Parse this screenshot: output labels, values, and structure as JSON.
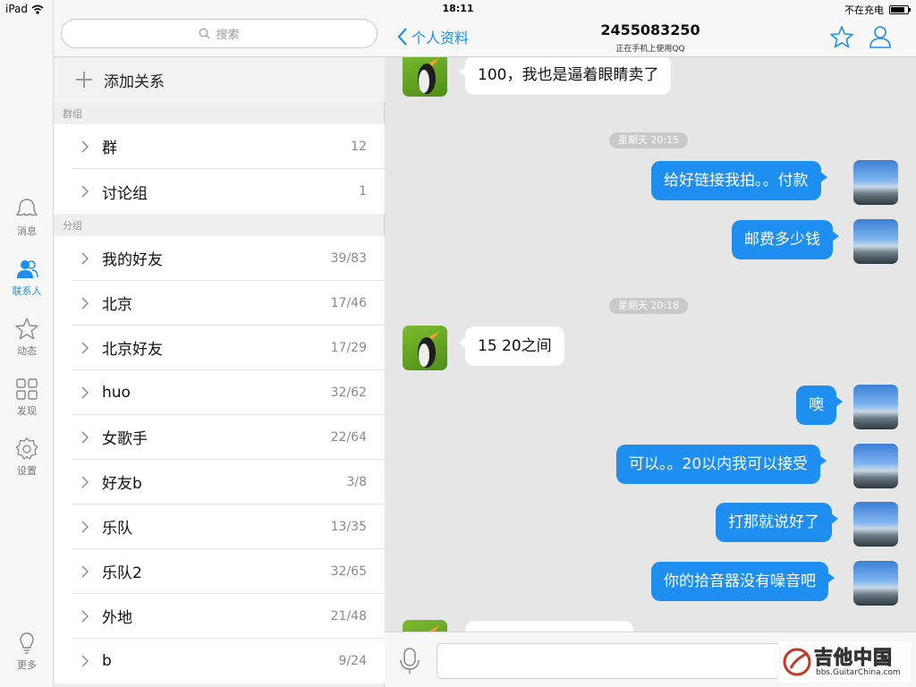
{
  "status_bar": {
    "device": "iPad",
    "time": "18:11",
    "charging": "不在充电",
    "battery_level": 0.85
  },
  "rail": {
    "items": [
      {
        "label": "消息",
        "icon": "chat-bubble-icon"
      },
      {
        "label": "联系人",
        "icon": "contacts-icon",
        "active": true
      },
      {
        "label": "动态",
        "icon": "star-icon"
      },
      {
        "label": "发现",
        "icon": "grid-icon"
      },
      {
        "label": "设置",
        "icon": "gear-icon"
      },
      {
        "label": "更多",
        "icon": "bulb-icon"
      }
    ]
  },
  "contacts": {
    "search_placeholder": "搜索",
    "add_relation": "添加关系",
    "groups_section": "群组",
    "groups": [
      {
        "name": "群",
        "count": "12"
      },
      {
        "name": "讨论组",
        "count": "1"
      }
    ],
    "friends_section": "分组",
    "friend_groups": [
      {
        "name": "我的好友",
        "count": "39/83"
      },
      {
        "name": "北京",
        "count": "17/46"
      },
      {
        "name": "北京好友",
        "count": "17/29"
      },
      {
        "name": "huo",
        "count": "32/62"
      },
      {
        "name": "女歌手",
        "count": "22/64"
      },
      {
        "name": "好友b",
        "count": "3/8"
      },
      {
        "name": "乐队",
        "count": "13/35"
      },
      {
        "name": "乐队2",
        "count": "32/65"
      },
      {
        "name": "外地",
        "count": "21/48"
      },
      {
        "name": "b",
        "count": "9/24"
      }
    ]
  },
  "chat": {
    "back_label": "个人资料",
    "title": "2455083250",
    "subtitle": "正在手机上使用QQ",
    "messages": {
      "m1": "100，我也是逼着眼睛卖了",
      "ts1": "星期天 20:15",
      "m2": "给好链接我拍。。付款",
      "m3": "邮费多少钱",
      "ts2": "星期天 20:18",
      "m4": "15  20之间",
      "m5": "噢",
      "m6": "可以。。20以内我可以接受",
      "m7": "打那就说好了",
      "m8": "你的拾音器没有噪音吧"
    }
  },
  "watermark": {
    "title": "吉他中国",
    "url": "bbs.GuitarChina.com"
  },
  "colors": {
    "accent": "#1e8ef0",
    "bubble_out": "#1e8ef0",
    "bubble_in": "#ffffff"
  }
}
